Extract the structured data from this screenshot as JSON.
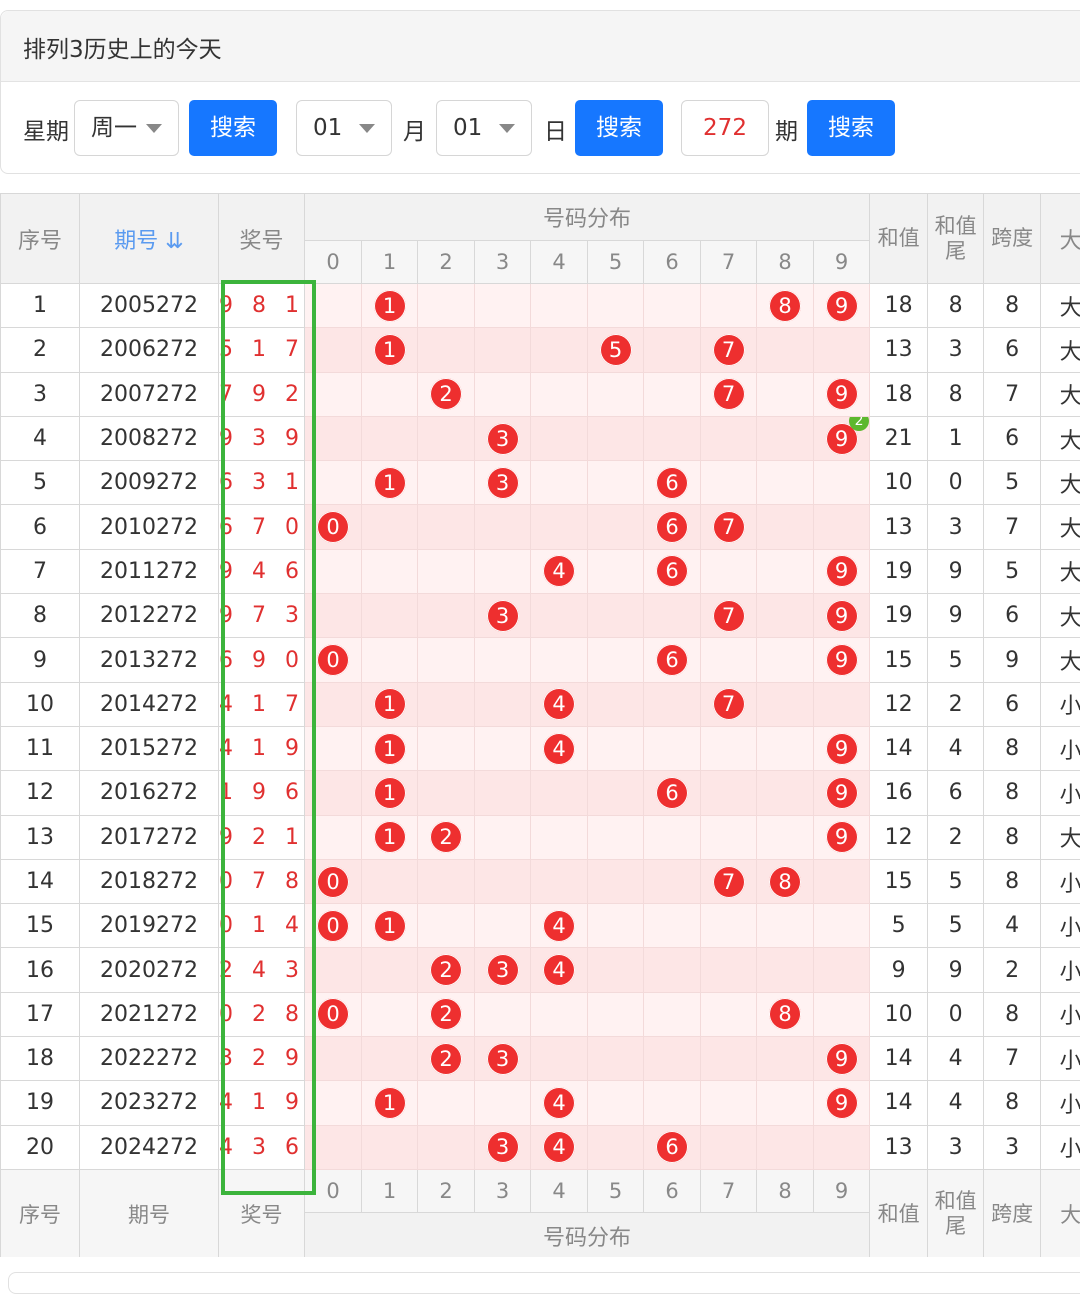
{
  "panel": {
    "title": "排列3历史上的今天",
    "weekday_label": "星期",
    "weekday_value": "周一",
    "search_label": "搜索",
    "month_value": "01",
    "month_label": "月",
    "day_value": "01",
    "day_label": "日",
    "issue_value": "272",
    "issue_label": "期"
  },
  "table": {
    "headers": {
      "seq": "序号",
      "issue": "期号",
      "sort_icon": "⇊",
      "prize": "奖号",
      "dist": "号码分布",
      "sum": "和值",
      "sum_tail": "和值尾",
      "span": "跨度",
      "size": "大"
    },
    "digits": [
      "0",
      "1",
      "2",
      "3",
      "4",
      "5",
      "6",
      "7",
      "8",
      "9"
    ],
    "rows": [
      {
        "seq": "1",
        "issue": "2005272",
        "prize": "9 8 1",
        "balls": [
          1,
          8,
          9
        ],
        "sum": "18",
        "tail": "8",
        "span": "8",
        "size": "大"
      },
      {
        "seq": "2",
        "issue": "2006272",
        "prize": "5 1 7",
        "balls": [
          1,
          5,
          7
        ],
        "sum": "13",
        "tail": "3",
        "span": "6",
        "size": "大"
      },
      {
        "seq": "3",
        "issue": "2007272",
        "prize": "7 9 2",
        "balls": [
          2,
          7,
          9
        ],
        "sum": "18",
        "tail": "8",
        "span": "7",
        "size": "大"
      },
      {
        "seq": "4",
        "issue": "2008272",
        "prize": "9 3 9",
        "balls": [
          3,
          9
        ],
        "badge": {
          "digit": 9,
          "count": "2"
        },
        "sum": "21",
        "tail": "1",
        "span": "6",
        "size": "大"
      },
      {
        "seq": "5",
        "issue": "2009272",
        "prize": "6 3 1",
        "balls": [
          1,
          3,
          6
        ],
        "sum": "10",
        "tail": "0",
        "span": "5",
        "size": "大"
      },
      {
        "seq": "6",
        "issue": "2010272",
        "prize": "6 7 0",
        "balls": [
          0,
          6,
          7
        ],
        "sum": "13",
        "tail": "3",
        "span": "7",
        "size": "大"
      },
      {
        "seq": "7",
        "issue": "2011272",
        "prize": "9 4 6",
        "balls": [
          4,
          6,
          9
        ],
        "sum": "19",
        "tail": "9",
        "span": "5",
        "size": "大"
      },
      {
        "seq": "8",
        "issue": "2012272",
        "prize": "9 7 3",
        "balls": [
          3,
          7,
          9
        ],
        "sum": "19",
        "tail": "9",
        "span": "6",
        "size": "大"
      },
      {
        "seq": "9",
        "issue": "2013272",
        "prize": "6 9 0",
        "balls": [
          0,
          6,
          9
        ],
        "sum": "15",
        "tail": "5",
        "span": "9",
        "size": "大"
      },
      {
        "seq": "10",
        "issue": "2014272",
        "prize": "4 1 7",
        "balls": [
          1,
          4,
          7
        ],
        "sum": "12",
        "tail": "2",
        "span": "6",
        "size": "小"
      },
      {
        "seq": "11",
        "issue": "2015272",
        "prize": "4 1 9",
        "balls": [
          1,
          4,
          9
        ],
        "sum": "14",
        "tail": "4",
        "span": "8",
        "size": "小"
      },
      {
        "seq": "12",
        "issue": "2016272",
        "prize": "1 9 6",
        "balls": [
          1,
          6,
          9
        ],
        "sum": "16",
        "tail": "6",
        "span": "8",
        "size": "小"
      },
      {
        "seq": "13",
        "issue": "2017272",
        "prize": "9 2 1",
        "balls": [
          1,
          2,
          9
        ],
        "sum": "12",
        "tail": "2",
        "span": "8",
        "size": "大"
      },
      {
        "seq": "14",
        "issue": "2018272",
        "prize": "0 7 8",
        "balls": [
          0,
          7,
          8
        ],
        "sum": "15",
        "tail": "5",
        "span": "8",
        "size": "小"
      },
      {
        "seq": "15",
        "issue": "2019272",
        "prize": "0 1 4",
        "balls": [
          0,
          1,
          4
        ],
        "sum": "5",
        "tail": "5",
        "span": "4",
        "size": "小"
      },
      {
        "seq": "16",
        "issue": "2020272",
        "prize": "2 4 3",
        "balls": [
          2,
          3,
          4
        ],
        "sum": "9",
        "tail": "9",
        "span": "2",
        "size": "小"
      },
      {
        "seq": "17",
        "issue": "2021272",
        "prize": "0 2 8",
        "balls": [
          0,
          2,
          8
        ],
        "sum": "10",
        "tail": "0",
        "span": "8",
        "size": "小"
      },
      {
        "seq": "18",
        "issue": "2022272",
        "prize": "3 2 9",
        "balls": [
          2,
          3,
          9
        ],
        "sum": "14",
        "tail": "4",
        "span": "7",
        "size": "小"
      },
      {
        "seq": "19",
        "issue": "2023272",
        "prize": "4 1 9",
        "balls": [
          1,
          4,
          9
        ],
        "sum": "14",
        "tail": "4",
        "span": "8",
        "size": "小"
      },
      {
        "seq": "20",
        "issue": "2024272",
        "prize": "4 3 6",
        "balls": [
          3,
          4,
          6
        ],
        "sum": "13",
        "tail": "3",
        "span": "3",
        "size": "小"
      }
    ]
  }
}
